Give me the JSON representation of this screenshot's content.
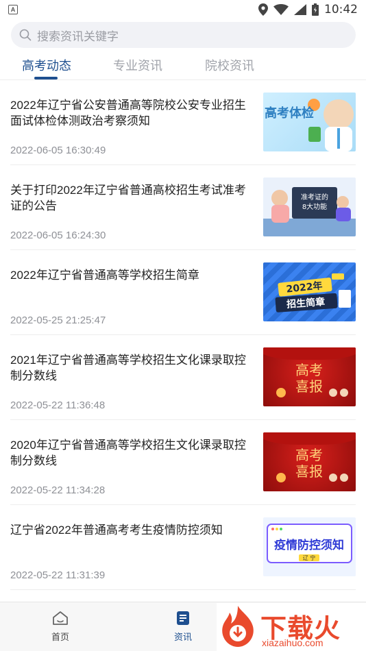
{
  "status_bar": {
    "time": "10:42",
    "app_badge": "A"
  },
  "search": {
    "placeholder": "搜索资讯关键字"
  },
  "tabs": [
    {
      "label": "高考动态",
      "active": true
    },
    {
      "label": "专业资讯",
      "active": false
    },
    {
      "label": "院校资讯",
      "active": false
    }
  ],
  "articles": [
    {
      "title": "2022年辽宁省公安普通高等院校公安专业招生面试体检体测政治考察须知",
      "date": "2022-06-05 16:30:49",
      "thumb_text": "高考体检"
    },
    {
      "title": "关于打印2022年辽宁省普通高校招生考试准考证的公告",
      "date": "2022-06-05 16:24:30",
      "thumb_text": "准考证的\n8大功能"
    },
    {
      "title": "2022年辽宁省普通高等学校招生简章",
      "date": "2022-05-25 21:25:47",
      "thumb_text": "2022年\n招生简章"
    },
    {
      "title": "2021年辽宁省普通高等学校招生文化课录取控制分数线",
      "date": "2022-05-22 11:36:48",
      "thumb_text": "高考\n喜报"
    },
    {
      "title": "2020年辽宁省普通高等学校招生文化课录取控制分数线",
      "date": "2022-05-22 11:34:28",
      "thumb_text": "高考\n喜报"
    },
    {
      "title": "辽宁省2022年普通高考考生疫情防控须知",
      "date": "2022-05-22 11:31:39",
      "thumb_text": "疫情防控须知"
    }
  ],
  "bottom_nav": [
    {
      "label": "首页",
      "icon": "home-icon",
      "active": false
    },
    {
      "label": "资讯",
      "icon": "news-icon",
      "active": true
    }
  ],
  "watermark": {
    "brand": "下载火",
    "domain": "xiazaihuo.com"
  },
  "colors": {
    "accent": "#1e4f8f",
    "watermark": "#e94a2d"
  }
}
